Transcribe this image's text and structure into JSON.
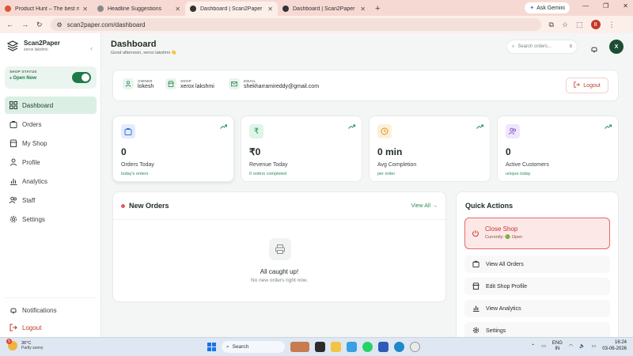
{
  "browser": {
    "tabs": [
      {
        "title": "Product Hunt – The best new p",
        "favicon_color": "#da552f",
        "active": false
      },
      {
        "title": "Headline Suggestions",
        "favicon_color": "#555555",
        "active": false
      },
      {
        "title": "Dashboard | Scan2Paper",
        "favicon_color": "#333333",
        "active": true
      },
      {
        "title": "Dashboard | Scan2Paper",
        "favicon_color": "#333333",
        "active": false
      }
    ],
    "new_tab": "+",
    "gemini": "Ask Gemini",
    "url": "scan2paper.com/dashboard",
    "profile_initial": "8"
  },
  "sidebar": {
    "brand": "Scan2Paper",
    "brand_sub": "xerox lakshmi",
    "shop_status_label": "SHOP STATUS",
    "shop_status_value": "Open Now",
    "nav": [
      {
        "label": "Dashboard",
        "icon": "grid-icon",
        "active": true
      },
      {
        "label": "Orders",
        "icon": "bag-icon",
        "active": false
      },
      {
        "label": "My Shop",
        "icon": "store-icon",
        "active": false
      },
      {
        "label": "Profile",
        "icon": "user-icon",
        "active": false
      },
      {
        "label": "Analytics",
        "icon": "chart-icon",
        "active": false
      },
      {
        "label": "Staff",
        "icon": "users-icon",
        "active": false
      },
      {
        "label": "Settings",
        "icon": "gear-icon",
        "active": false
      }
    ],
    "notifications": "Notifications",
    "logout": "Logout"
  },
  "header": {
    "title": "Dashboard",
    "greeting": "Good afternoon, xerox lakshmi 👋",
    "search_placeholder": "Search orders...",
    "avatar": "X"
  },
  "info": {
    "owner_label": "OWNER",
    "owner": "lokesh",
    "shop_label": "SHOP",
    "shop": "xerox lakshmi",
    "email_label": "EMAIL",
    "email": "shekharramireddy@gmail.com",
    "logout": "Logout"
  },
  "stats": [
    {
      "value": "0",
      "label": "Orders Today",
      "sub": "today's orders",
      "icon": "bag-icon",
      "bg": "#e3ecfb",
      "fg": "#3b6fd8"
    },
    {
      "value": "₹0",
      "label": "Revenue Today",
      "sub": "0 orders completed",
      "icon": "rupee-icon",
      "bg": "#def5e7",
      "fg": "#2d8a5a"
    },
    {
      "value": "0 min",
      "label": "Avg Completion",
      "sub": "per order",
      "icon": "clock-icon",
      "bg": "#fdf0d9",
      "fg": "#d6961e"
    },
    {
      "value": "0",
      "label": "Active Customers",
      "sub": "unique today",
      "icon": "users-icon",
      "bg": "#efe6fb",
      "fg": "#8a5cd8"
    }
  ],
  "orders": {
    "title": "New Orders",
    "view_all": "View All →",
    "empty_title": "All caught up!",
    "empty_sub": "No new orders right now."
  },
  "quick": {
    "title": "Quick Actions",
    "close_title": "Close Shop",
    "close_sub": "Currently: 🟢 Open",
    "actions": [
      {
        "label": "View All Orders",
        "icon": "bag-icon"
      },
      {
        "label": "Edit Shop Profile",
        "icon": "store-icon"
      },
      {
        "label": "View Analytics",
        "icon": "chart-icon"
      },
      {
        "label": "Settings",
        "icon": "gear-icon"
      }
    ]
  },
  "taskbar": {
    "weather_badge": "5",
    "temp": "36°C",
    "weather": "Partly sunny",
    "search": "Search",
    "lang_line1": "ENG",
    "lang_line2": "IN",
    "time": "16:24",
    "date": "03-06-2026"
  },
  "colors": {
    "accent": "#1f7a4a",
    "danger": "#c0392b",
    "sidebar_active": "#dcefe4"
  }
}
